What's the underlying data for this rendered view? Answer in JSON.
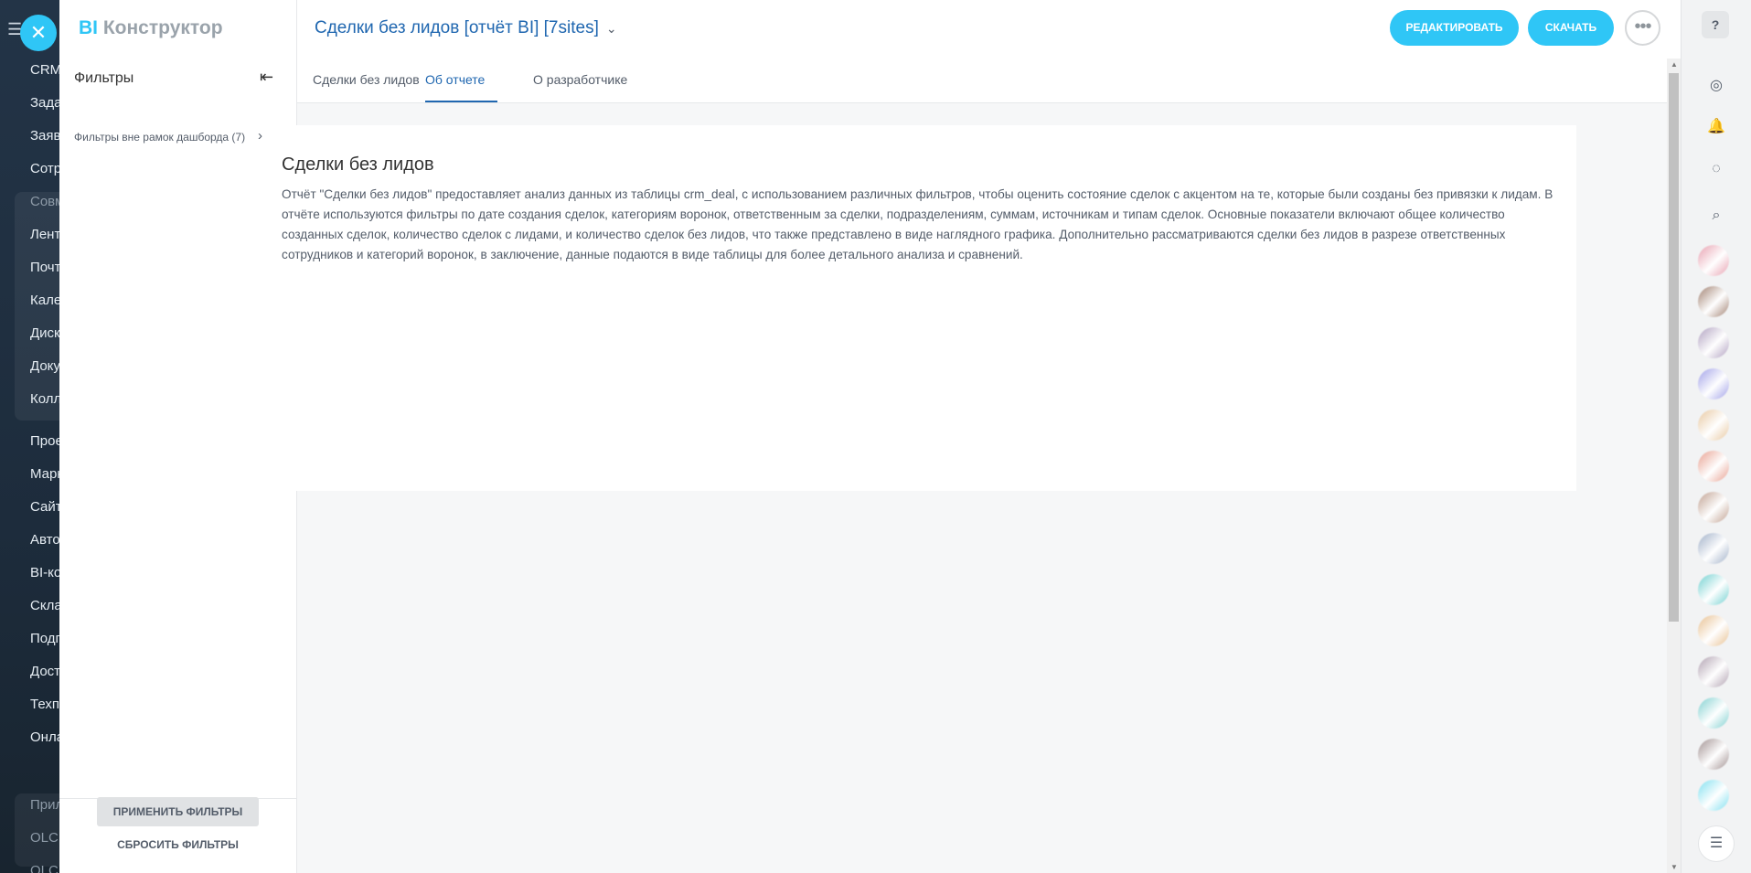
{
  "portal_nav": {
    "items": [
      "CRM",
      "Зада",
      "Заяв",
      "Сотр",
      "Совм",
      "Лент",
      "Почт",
      "Кале",
      "Диск",
      "Доку",
      "Колл",
      "Прое",
      "Марк",
      "Сайт",
      "Авто",
      "BI-ко",
      "Скла",
      "Подп",
      "Дост",
      "Техп",
      "Онла",
      "Прил",
      "OLCI",
      "OLCI"
    ]
  },
  "logo": {
    "bi": "BI",
    "rest": "Конструктор"
  },
  "filters": {
    "title": "Фильтры",
    "group_label": "Фильтры вне рамок дашборда (7)",
    "apply_label": "ПРИМЕНИТЬ ФИЛЬТРЫ",
    "reset_label": "СБРОСИТЬ ФИЛЬТРЫ"
  },
  "header": {
    "title": "Сделки без лидов [отчёт BI] [7sites]",
    "edit_label": "РЕДАКТИРОВАТЬ",
    "download_label": "СКАЧАТЬ",
    "more_label": "•••"
  },
  "tabs": [
    {
      "label": "Сделки без лидов",
      "active": false
    },
    {
      "label": "Об отчете",
      "active": true
    },
    {
      "label": "О разработчике",
      "active": false
    }
  ],
  "content": {
    "heading": "Сделки без лидов",
    "description": "Отчёт \"Сделки без лидов\" предоставляет анализ данных из таблицы crm_deal, с использованием различных фильтров, чтобы оценить состояние сделок с акцентом на те, которые были созданы без привязки к лидам. В отчёте используются фильтры по дате создания сделок, категориям воронок, ответственным за сделки, подразделениям, суммам, источникам и типам сделок. Основные показатели включают общее количество созданных сделок, количество сделок с лидами, и количество сделок без лидов, что также представлено в виде наглядного графика. Дополнительно рассматриваются сделки без лидов в разрезе ответственных сотрудников и категорий воронок, в заключение, данные подаются в виде таблицы для более детального анализа и сравнений."
  },
  "right_panel": {
    "help": "?",
    "avatar_colors": [
      "#e8a0b0",
      "#a08070",
      "#b0a0c0",
      "#a0a0e8",
      "#e8c8a0",
      "#e8a090",
      "#c0a090",
      "#a0b0c8",
      "#70d0d0",
      "#e8c090",
      "#b0a0b0",
      "#80d0d0",
      "#a09090",
      "#80e0f0"
    ]
  },
  "colors": {
    "accent": "#2fc6f6",
    "link": "#2067b0"
  }
}
